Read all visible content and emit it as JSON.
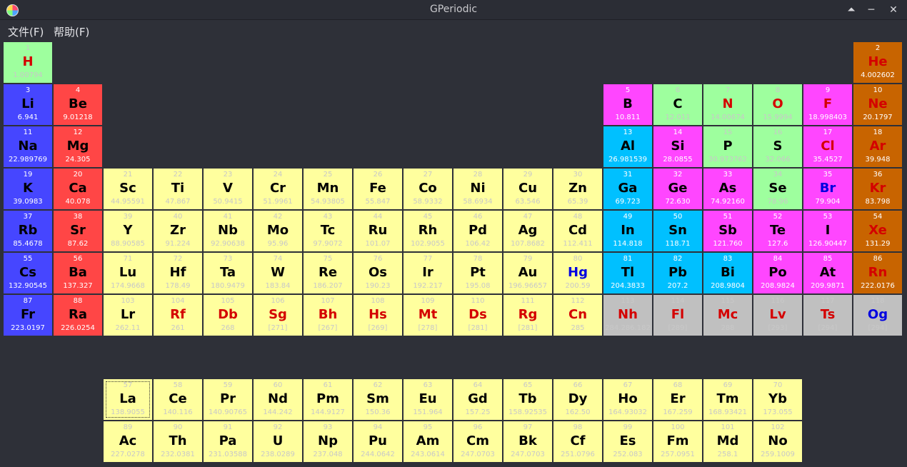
{
  "window": {
    "title": "GPeriodic"
  },
  "menu": [
    {
      "label": "文件(F)"
    },
    {
      "label": "帮助(F)"
    }
  ],
  "colors": {
    "alkali": "#4646ff",
    "alkaline": "#ff4646",
    "transition": "#ffff9e",
    "metalloid": "#ff46ff",
    "poor": "#00c0ff",
    "nonmetal": "#9eff9e",
    "noble": "#c86400",
    "unknown": "#c0c0c0",
    "lanthanide": "#ffff9e",
    "actinide": "#ffff9e",
    "hydrogen": "#9eff9e"
  },
  "elements": [
    {
      "n": "1",
      "s": "H",
      "m": "1.00794",
      "r": 1,
      "c": 1,
      "k": "hydrogen",
      "sc": "red"
    },
    {
      "n": "2",
      "s": "He",
      "m": "4.002602",
      "r": 1,
      "c": 18,
      "k": "noble",
      "sc": "red"
    },
    {
      "n": "3",
      "s": "Li",
      "m": "6.941",
      "r": 2,
      "c": 1,
      "k": "alkali",
      "sc": "black"
    },
    {
      "n": "4",
      "s": "Be",
      "m": "9.01218",
      "r": 2,
      "c": 2,
      "k": "alkaline",
      "sc": "black"
    },
    {
      "n": "5",
      "s": "B",
      "m": "10.811",
      "r": 2,
      "c": 13,
      "k": "metalloid",
      "sc": "black"
    },
    {
      "n": "6",
      "s": "C",
      "m": "12.011",
      "r": 2,
      "c": 14,
      "k": "nonmetal",
      "sc": "black"
    },
    {
      "n": "7",
      "s": "N",
      "m": "14.00674",
      "r": 2,
      "c": 15,
      "k": "nonmetal",
      "sc": "red"
    },
    {
      "n": "8",
      "s": "O",
      "m": "15.9994",
      "r": 2,
      "c": 16,
      "k": "nonmetal",
      "sc": "red"
    },
    {
      "n": "9",
      "s": "F",
      "m": "18.998403",
      "r": 2,
      "c": 17,
      "k": "metalloid",
      "sc": "red"
    },
    {
      "n": "10",
      "s": "Ne",
      "m": "20.1797",
      "r": 2,
      "c": 18,
      "k": "noble",
      "sc": "red"
    },
    {
      "n": "11",
      "s": "Na",
      "m": "22.989769",
      "r": 3,
      "c": 1,
      "k": "alkali",
      "sc": "black"
    },
    {
      "n": "12",
      "s": "Mg",
      "m": "24.305",
      "r": 3,
      "c": 2,
      "k": "alkaline",
      "sc": "black"
    },
    {
      "n": "13",
      "s": "Al",
      "m": "26.981539",
      "r": 3,
      "c": 13,
      "k": "poor",
      "sc": "black"
    },
    {
      "n": "14",
      "s": "Si",
      "m": "28.0855",
      "r": 3,
      "c": 14,
      "k": "metalloid",
      "sc": "black"
    },
    {
      "n": "15",
      "s": "P",
      "m": "30.973762",
      "r": 3,
      "c": 15,
      "k": "nonmetal",
      "sc": "black"
    },
    {
      "n": "16",
      "s": "S",
      "m": "32.066",
      "r": 3,
      "c": 16,
      "k": "nonmetal",
      "sc": "black"
    },
    {
      "n": "17",
      "s": "Cl",
      "m": "35.4527",
      "r": 3,
      "c": 17,
      "k": "metalloid",
      "sc": "red"
    },
    {
      "n": "18",
      "s": "Ar",
      "m": "39.948",
      "r": 3,
      "c": 18,
      "k": "noble",
      "sc": "red"
    },
    {
      "n": "19",
      "s": "K",
      "m": "39.0983",
      "r": 4,
      "c": 1,
      "k": "alkali",
      "sc": "black"
    },
    {
      "n": "20",
      "s": "Ca",
      "m": "40.078",
      "r": 4,
      "c": 2,
      "k": "alkaline",
      "sc": "black"
    },
    {
      "n": "21",
      "s": "Sc",
      "m": "44.95591",
      "r": 4,
      "c": 3,
      "k": "transition",
      "sc": "black"
    },
    {
      "n": "22",
      "s": "Ti",
      "m": "47.867",
      "r": 4,
      "c": 4,
      "k": "transition",
      "sc": "black"
    },
    {
      "n": "23",
      "s": "V",
      "m": "50.9415",
      "r": 4,
      "c": 5,
      "k": "transition",
      "sc": "black"
    },
    {
      "n": "24",
      "s": "Cr",
      "m": "51.9961",
      "r": 4,
      "c": 6,
      "k": "transition",
      "sc": "black"
    },
    {
      "n": "25",
      "s": "Mn",
      "m": "54.93805",
      "r": 4,
      "c": 7,
      "k": "transition",
      "sc": "black"
    },
    {
      "n": "26",
      "s": "Fe",
      "m": "55.847",
      "r": 4,
      "c": 8,
      "k": "transition",
      "sc": "black"
    },
    {
      "n": "27",
      "s": "Co",
      "m": "58.9332",
      "r": 4,
      "c": 9,
      "k": "transition",
      "sc": "black"
    },
    {
      "n": "28",
      "s": "Ni",
      "m": "58.6934",
      "r": 4,
      "c": 10,
      "k": "transition",
      "sc": "black"
    },
    {
      "n": "29",
      "s": "Cu",
      "m": "63.546",
      "r": 4,
      "c": 11,
      "k": "transition",
      "sc": "black"
    },
    {
      "n": "30",
      "s": "Zn",
      "m": "65.39",
      "r": 4,
      "c": 12,
      "k": "transition",
      "sc": "black"
    },
    {
      "n": "31",
      "s": "Ga",
      "m": "69.723",
      "r": 4,
      "c": 13,
      "k": "poor",
      "sc": "black"
    },
    {
      "n": "32",
      "s": "Ge",
      "m": "72.630",
      "r": 4,
      "c": 14,
      "k": "metalloid",
      "sc": "black"
    },
    {
      "n": "33",
      "s": "As",
      "m": "74.92160",
      "r": 4,
      "c": 15,
      "k": "metalloid",
      "sc": "black"
    },
    {
      "n": "34",
      "s": "Se",
      "m": "78.96",
      "r": 4,
      "c": 16,
      "k": "nonmetal",
      "sc": "black"
    },
    {
      "n": "35",
      "s": "Br",
      "m": "79.904",
      "r": 4,
      "c": 17,
      "k": "metalloid",
      "sc": "blue"
    },
    {
      "n": "36",
      "s": "Kr",
      "m": "83.798",
      "r": 4,
      "c": 18,
      "k": "noble",
      "sc": "red"
    },
    {
      "n": "37",
      "s": "Rb",
      "m": "85.4678",
      "r": 5,
      "c": 1,
      "k": "alkali",
      "sc": "black"
    },
    {
      "n": "38",
      "s": "Sr",
      "m": "87.62",
      "r": 5,
      "c": 2,
      "k": "alkaline",
      "sc": "black"
    },
    {
      "n": "39",
      "s": "Y",
      "m": "88.90585",
      "r": 5,
      "c": 3,
      "k": "transition",
      "sc": "black"
    },
    {
      "n": "40",
      "s": "Zr",
      "m": "91.224",
      "r": 5,
      "c": 4,
      "k": "transition",
      "sc": "black"
    },
    {
      "n": "41",
      "s": "Nb",
      "m": "92.90638",
      "r": 5,
      "c": 5,
      "k": "transition",
      "sc": "black"
    },
    {
      "n": "42",
      "s": "Mo",
      "m": "95.96",
      "r": 5,
      "c": 6,
      "k": "transition",
      "sc": "black"
    },
    {
      "n": "43",
      "s": "Tc",
      "m": "97.9072",
      "r": 5,
      "c": 7,
      "k": "transition",
      "sc": "black"
    },
    {
      "n": "44",
      "s": "Ru",
      "m": "101.07",
      "r": 5,
      "c": 8,
      "k": "transition",
      "sc": "black"
    },
    {
      "n": "45",
      "s": "Rh",
      "m": "102.9055",
      "r": 5,
      "c": 9,
      "k": "transition",
      "sc": "black"
    },
    {
      "n": "46",
      "s": "Pd",
      "m": "106.42",
      "r": 5,
      "c": 10,
      "k": "transition",
      "sc": "black"
    },
    {
      "n": "47",
      "s": "Ag",
      "m": "107.8682",
      "r": 5,
      "c": 11,
      "k": "transition",
      "sc": "black"
    },
    {
      "n": "48",
      "s": "Cd",
      "m": "112.411",
      "r": 5,
      "c": 12,
      "k": "transition",
      "sc": "black"
    },
    {
      "n": "49",
      "s": "In",
      "m": "114.818",
      "r": 5,
      "c": 13,
      "k": "poor",
      "sc": "black"
    },
    {
      "n": "50",
      "s": "Sn",
      "m": "118.71",
      "r": 5,
      "c": 14,
      "k": "poor",
      "sc": "black"
    },
    {
      "n": "51",
      "s": "Sb",
      "m": "121.760",
      "r": 5,
      "c": 15,
      "k": "metalloid",
      "sc": "black"
    },
    {
      "n": "52",
      "s": "Te",
      "m": "127.6",
      "r": 5,
      "c": 16,
      "k": "metalloid",
      "sc": "black"
    },
    {
      "n": "53",
      "s": "I",
      "m": "126.90447",
      "r": 5,
      "c": 17,
      "k": "metalloid",
      "sc": "black"
    },
    {
      "n": "54",
      "s": "Xe",
      "m": "131.29",
      "r": 5,
      "c": 18,
      "k": "noble",
      "sc": "red"
    },
    {
      "n": "55",
      "s": "Cs",
      "m": "132.90545",
      "r": 6,
      "c": 1,
      "k": "alkali",
      "sc": "black"
    },
    {
      "n": "56",
      "s": "Ba",
      "m": "137.327",
      "r": 6,
      "c": 2,
      "k": "alkaline",
      "sc": "black"
    },
    {
      "n": "71",
      "s": "Lu",
      "m": "174.9668",
      "r": 6,
      "c": 3,
      "k": "transition",
      "sc": "black"
    },
    {
      "n": "72",
      "s": "Hf",
      "m": "178.49",
      "r": 6,
      "c": 4,
      "k": "transition",
      "sc": "black"
    },
    {
      "n": "73",
      "s": "Ta",
      "m": "180.9479",
      "r": 6,
      "c": 5,
      "k": "transition",
      "sc": "black"
    },
    {
      "n": "74",
      "s": "W",
      "m": "183.84",
      "r": 6,
      "c": 6,
      "k": "transition",
      "sc": "black"
    },
    {
      "n": "75",
      "s": "Re",
      "m": "186.207",
      "r": 6,
      "c": 7,
      "k": "transition",
      "sc": "black"
    },
    {
      "n": "76",
      "s": "Os",
      "m": "190.23",
      "r": 6,
      "c": 8,
      "k": "transition",
      "sc": "black"
    },
    {
      "n": "77",
      "s": "Ir",
      "m": "192.217",
      "r": 6,
      "c": 9,
      "k": "transition",
      "sc": "black"
    },
    {
      "n": "78",
      "s": "Pt",
      "m": "195.08",
      "r": 6,
      "c": 10,
      "k": "transition",
      "sc": "black"
    },
    {
      "n": "79",
      "s": "Au",
      "m": "196.96657",
      "r": 6,
      "c": 11,
      "k": "transition",
      "sc": "black"
    },
    {
      "n": "80",
      "s": "Hg",
      "m": "200.59",
      "r": 6,
      "c": 12,
      "k": "transition",
      "sc": "blue"
    },
    {
      "n": "81",
      "s": "Tl",
      "m": "204.3833",
      "r": 6,
      "c": 13,
      "k": "poor",
      "sc": "black"
    },
    {
      "n": "82",
      "s": "Pb",
      "m": "207.2",
      "r": 6,
      "c": 14,
      "k": "poor",
      "sc": "black"
    },
    {
      "n": "83",
      "s": "Bi",
      "m": "208.9804",
      "r": 6,
      "c": 15,
      "k": "poor",
      "sc": "black"
    },
    {
      "n": "84",
      "s": "Po",
      "m": "208.9824",
      "r": 6,
      "c": 16,
      "k": "metalloid",
      "sc": "black"
    },
    {
      "n": "85",
      "s": "At",
      "m": "209.9871",
      "r": 6,
      "c": 17,
      "k": "metalloid",
      "sc": "black"
    },
    {
      "n": "86",
      "s": "Rn",
      "m": "222.0176",
      "r": 6,
      "c": 18,
      "k": "noble",
      "sc": "red"
    },
    {
      "n": "87",
      "s": "Fr",
      "m": "223.0197",
      "r": 7,
      "c": 1,
      "k": "alkali",
      "sc": "black"
    },
    {
      "n": "88",
      "s": "Ra",
      "m": "226.0254",
      "r": 7,
      "c": 2,
      "k": "alkaline",
      "sc": "black"
    },
    {
      "n": "103",
      "s": "Lr",
      "m": "262.11",
      "r": 7,
      "c": 3,
      "k": "transition",
      "sc": "black"
    },
    {
      "n": "104",
      "s": "Rf",
      "m": "261",
      "r": 7,
      "c": 4,
      "k": "transition",
      "sc": "red"
    },
    {
      "n": "105",
      "s": "Db",
      "m": "268",
      "r": 7,
      "c": 5,
      "k": "transition",
      "sc": "red"
    },
    {
      "n": "106",
      "s": "Sg",
      "m": "[271]",
      "r": 7,
      "c": 6,
      "k": "transition",
      "sc": "red"
    },
    {
      "n": "107",
      "s": "Bh",
      "m": "[267]",
      "r": 7,
      "c": 7,
      "k": "transition",
      "sc": "red"
    },
    {
      "n": "108",
      "s": "Hs",
      "m": "[269]",
      "r": 7,
      "c": 8,
      "k": "transition",
      "sc": "red"
    },
    {
      "n": "109",
      "s": "Mt",
      "m": "[278]",
      "r": 7,
      "c": 9,
      "k": "transition",
      "sc": "red"
    },
    {
      "n": "110",
      "s": "Ds",
      "m": "[281]",
      "r": 7,
      "c": 10,
      "k": "transition",
      "sc": "red"
    },
    {
      "n": "111",
      "s": "Rg",
      "m": "[281]",
      "r": 7,
      "c": 11,
      "k": "transition",
      "sc": "red"
    },
    {
      "n": "112",
      "s": "Cn",
      "m": "285",
      "r": 7,
      "c": 12,
      "k": "transition",
      "sc": "red"
    },
    {
      "n": "113",
      "s": "Nh",
      "m": "284.286.182",
      "r": 7,
      "c": 13,
      "k": "unknown",
      "sc": "red"
    },
    {
      "n": "114",
      "s": "Fl",
      "m": "[289]",
      "r": 7,
      "c": 14,
      "k": "unknown",
      "sc": "red"
    },
    {
      "n": "115",
      "s": "Mc",
      "m": "288",
      "r": 7,
      "c": 15,
      "k": "unknown",
      "sc": "red"
    },
    {
      "n": "116",
      "s": "Lv",
      "m": "[293]",
      "r": 7,
      "c": 16,
      "k": "unknown",
      "sc": "red"
    },
    {
      "n": "117",
      "s": "Ts",
      "m": "[294]",
      "r": 7,
      "c": 17,
      "k": "unknown",
      "sc": "red"
    },
    {
      "n": "118",
      "s": "Og",
      "m": "[294]",
      "r": 7,
      "c": 18,
      "k": "unknown",
      "sc": "blue"
    },
    {
      "n": "57",
      "s": "La",
      "m": "138.9055",
      "r": 9,
      "c": 3,
      "k": "lanthanide",
      "sc": "black",
      "sel": true
    },
    {
      "n": "58",
      "s": "Ce",
      "m": "140.116",
      "r": 9,
      "c": 4,
      "k": "lanthanide",
      "sc": "black"
    },
    {
      "n": "59",
      "s": "Pr",
      "m": "140.90765",
      "r": 9,
      "c": 5,
      "k": "lanthanide",
      "sc": "black"
    },
    {
      "n": "60",
      "s": "Nd",
      "m": "144.242",
      "r": 9,
      "c": 6,
      "k": "lanthanide",
      "sc": "black"
    },
    {
      "n": "61",
      "s": "Pm",
      "m": "144.9127",
      "r": 9,
      "c": 7,
      "k": "lanthanide",
      "sc": "black"
    },
    {
      "n": "62",
      "s": "Sm",
      "m": "150.36",
      "r": 9,
      "c": 8,
      "k": "lanthanide",
      "sc": "black"
    },
    {
      "n": "63",
      "s": "Eu",
      "m": "151.964",
      "r": 9,
      "c": 9,
      "k": "lanthanide",
      "sc": "black"
    },
    {
      "n": "64",
      "s": "Gd",
      "m": "157.25",
      "r": 9,
      "c": 10,
      "k": "lanthanide",
      "sc": "black"
    },
    {
      "n": "65",
      "s": "Tb",
      "m": "158.92535",
      "r": 9,
      "c": 11,
      "k": "lanthanide",
      "sc": "black"
    },
    {
      "n": "66",
      "s": "Dy",
      "m": "162.50",
      "r": 9,
      "c": 12,
      "k": "lanthanide",
      "sc": "black"
    },
    {
      "n": "67",
      "s": "Ho",
      "m": "164.93032",
      "r": 9,
      "c": 13,
      "k": "lanthanide",
      "sc": "black"
    },
    {
      "n": "68",
      "s": "Er",
      "m": "167.259",
      "r": 9,
      "c": 14,
      "k": "lanthanide",
      "sc": "black"
    },
    {
      "n": "69",
      "s": "Tm",
      "m": "168.93421",
      "r": 9,
      "c": 15,
      "k": "lanthanide",
      "sc": "black"
    },
    {
      "n": "70",
      "s": "Yb",
      "m": "173.055",
      "r": 9,
      "c": 16,
      "k": "lanthanide",
      "sc": "black"
    },
    {
      "n": "89",
      "s": "Ac",
      "m": "227.0278",
      "r": 10,
      "c": 3,
      "k": "actinide",
      "sc": "black"
    },
    {
      "n": "90",
      "s": "Th",
      "m": "232.0381",
      "r": 10,
      "c": 4,
      "k": "actinide",
      "sc": "black"
    },
    {
      "n": "91",
      "s": "Pa",
      "m": "231.03588",
      "r": 10,
      "c": 5,
      "k": "actinide",
      "sc": "black"
    },
    {
      "n": "92",
      "s": "U",
      "m": "238.0289",
      "r": 10,
      "c": 6,
      "k": "actinide",
      "sc": "black"
    },
    {
      "n": "93",
      "s": "Np",
      "m": "237.048",
      "r": 10,
      "c": 7,
      "k": "actinide",
      "sc": "black"
    },
    {
      "n": "94",
      "s": "Pu",
      "m": "244.0642",
      "r": 10,
      "c": 8,
      "k": "actinide",
      "sc": "black"
    },
    {
      "n": "95",
      "s": "Am",
      "m": "243.0614",
      "r": 10,
      "c": 9,
      "k": "actinide",
      "sc": "black"
    },
    {
      "n": "96",
      "s": "Cm",
      "m": "247.0703",
      "r": 10,
      "c": 10,
      "k": "actinide",
      "sc": "black"
    },
    {
      "n": "97",
      "s": "Bk",
      "m": "247.0703",
      "r": 10,
      "c": 11,
      "k": "actinide",
      "sc": "black"
    },
    {
      "n": "98",
      "s": "Cf",
      "m": "251.0796",
      "r": 10,
      "c": 12,
      "k": "actinide",
      "sc": "black"
    },
    {
      "n": "99",
      "s": "Es",
      "m": "252.083",
      "r": 10,
      "c": 13,
      "k": "actinide",
      "sc": "black"
    },
    {
      "n": "100",
      "s": "Fm",
      "m": "257.0951",
      "r": 10,
      "c": 14,
      "k": "actinide",
      "sc": "black"
    },
    {
      "n": "101",
      "s": "Md",
      "m": "258.1",
      "r": 10,
      "c": 15,
      "k": "actinide",
      "sc": "black"
    },
    {
      "n": "102",
      "s": "No",
      "m": "259.1009",
      "r": 10,
      "c": 16,
      "k": "actinide",
      "sc": "black"
    }
  ]
}
